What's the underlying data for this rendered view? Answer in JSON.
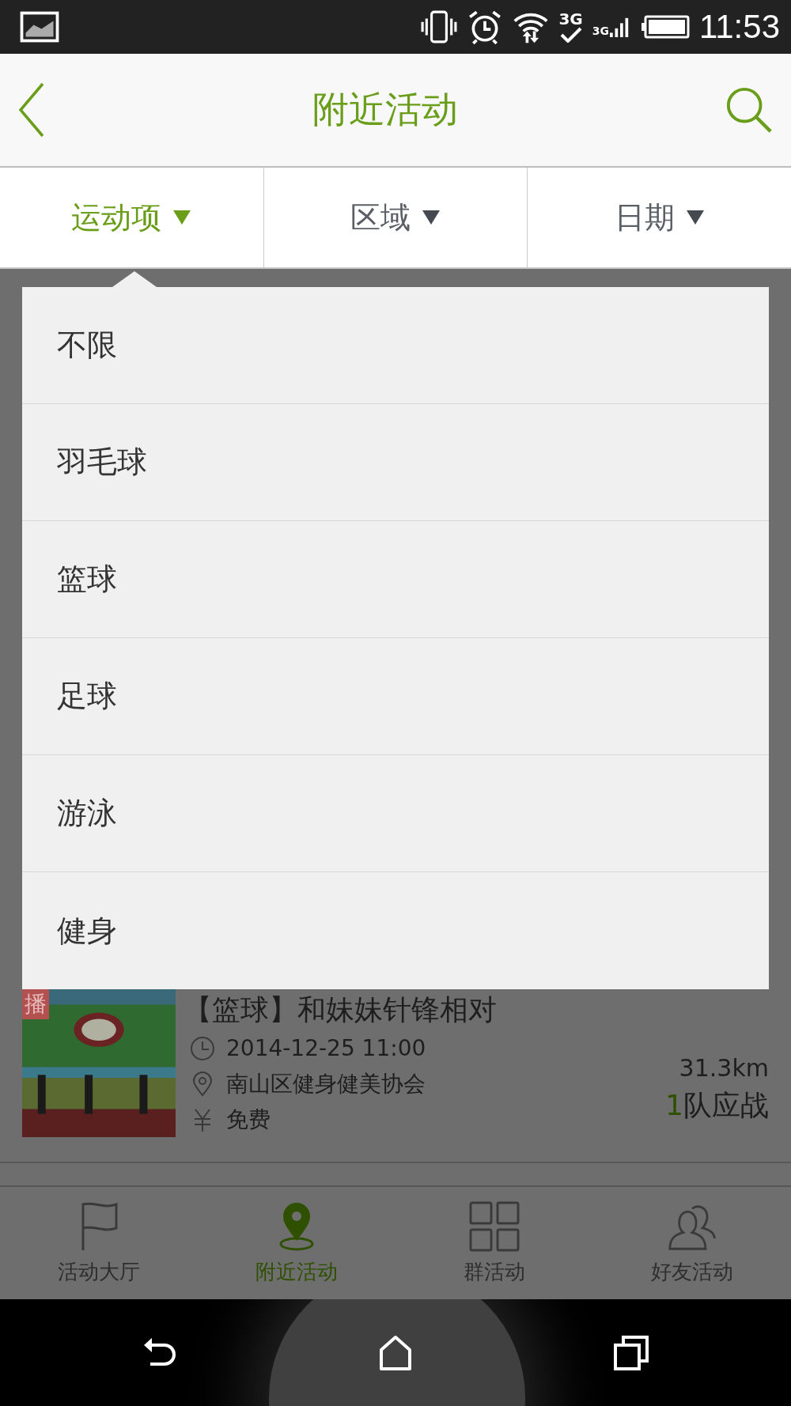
{
  "status_bar": {
    "time": "11:53",
    "network": "3G",
    "signal_label": "3G"
  },
  "header": {
    "title": "附近活动"
  },
  "filters": [
    {
      "label": "运动项",
      "selected": true
    },
    {
      "label": "区域",
      "selected": false
    },
    {
      "label": "日期",
      "selected": false
    }
  ],
  "dropdown": {
    "options": [
      {
        "label": "不限"
      },
      {
        "label": "羽毛球"
      },
      {
        "label": "篮球"
      },
      {
        "label": "足球"
      },
      {
        "label": "游泳"
      },
      {
        "label": "健身"
      }
    ]
  },
  "activities": [
    {
      "kind": "picture",
      "tag": "播",
      "title": "【篮球】和妹妹针锋相对",
      "datetime": "2014-12-25 11:00",
      "location": "南山区健身健美协会",
      "price": "免费",
      "distance": "31.3km",
      "count": "1",
      "count_label": "队应战"
    }
  ],
  "tabs": [
    {
      "kind": "flag",
      "label": "活动大厅",
      "selected": false
    },
    {
      "kind": "pin",
      "label": "附近活动",
      "selected": true
    },
    {
      "kind": "grid",
      "label": "群活动",
      "selected": false
    },
    {
      "kind": "friends",
      "label": "好友活动",
      "selected": false
    }
  ]
}
